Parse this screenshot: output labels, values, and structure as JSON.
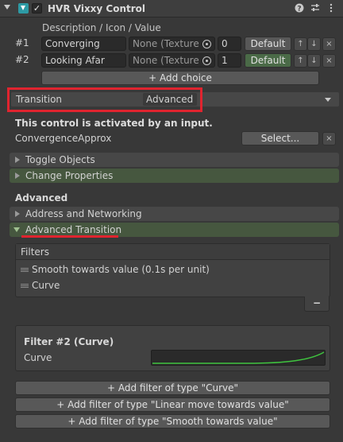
{
  "header": {
    "title": "HVR Vixxy Control"
  },
  "choices": {
    "column_header": "Description / Icon / Value",
    "rows": [
      {
        "index": "#1",
        "description": "Converging",
        "icon": "None (Texture",
        "value": "0",
        "default_label": "Default",
        "is_default": false
      },
      {
        "index": "#2",
        "description": "Looking Afar",
        "icon": "None (Texture",
        "value": "1",
        "default_label": "Default",
        "is_default": true
      }
    ],
    "add_choice_label": "+ Add choice"
  },
  "transition": {
    "label": "Transition",
    "value": "Advanced"
  },
  "activation": {
    "notice": "This control is activated by an input.",
    "input_name": "ConvergenceApprox",
    "select_label": "Select..."
  },
  "foldouts": {
    "toggle_objects": "Toggle Objects",
    "change_properties": "Change Properties"
  },
  "advanced": {
    "section_title": "Advanced",
    "address_networking": "Address and Networking",
    "advanced_transition": "Advanced Transition"
  },
  "filters": {
    "title": "Filters",
    "items": [
      "Smooth towards value (0.1s per unit)",
      "Curve"
    ],
    "remove_label": "−"
  },
  "filter_detail": {
    "title": "Filter #2 (Curve)",
    "field_label": "Curve"
  },
  "add_filters": [
    "+ Add filter of type \"Curve\"",
    "+ Add filter of type \"Linear move towards value\"",
    "+ Add filter of type \"Smooth towards value\""
  ],
  "colors": {
    "highlight_red": "#e0242f",
    "curve_green": "#3fc43f",
    "panel_green": "#46573f"
  }
}
